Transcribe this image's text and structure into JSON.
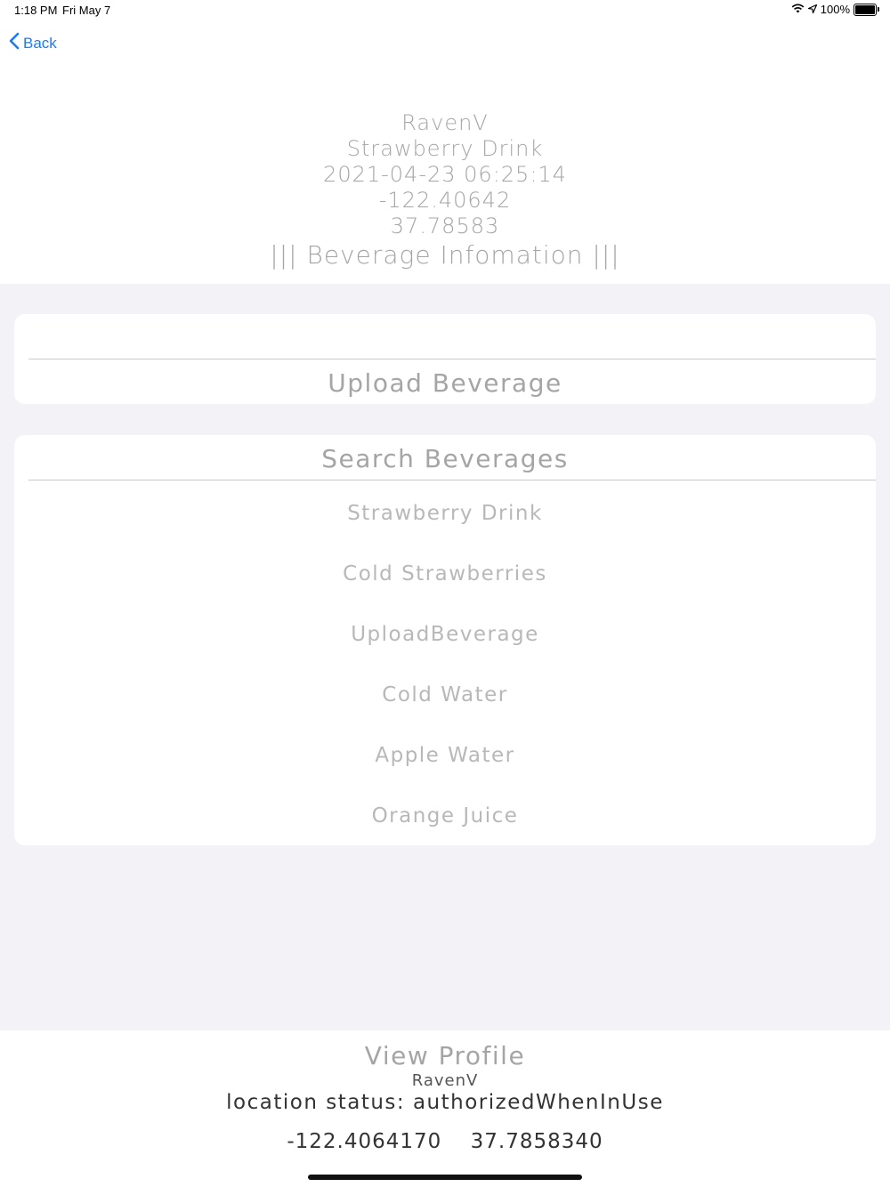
{
  "status_bar": {
    "time": "1:18 PM",
    "date": "Fri May 7",
    "battery": "100%",
    "icons": [
      "wifi-icon",
      "location-arrow-icon",
      "battery-icon"
    ]
  },
  "nav": {
    "back_label": "Back",
    "accent_color": "#1a7cf5"
  },
  "info": {
    "user": "RavenV",
    "beverage": "Strawberry Drink",
    "timestamp": "2021-04-23 06:25:14",
    "longitude": "-122.40642",
    "latitude": "37.78583",
    "section_title": "||| Beverage Infomation |||"
  },
  "actions": {
    "upload_label": "Upload Beverage"
  },
  "search": {
    "header_label": "Search Beverages",
    "items": [
      "Strawberry Drink",
      "Cold Strawberries",
      "UploadBeverage",
      "Cold Water",
      "Apple Water",
      "Orange Juice"
    ]
  },
  "footer": {
    "view_profile_label": "View Profile",
    "user": "RavenV",
    "location_status": "location status: authorizedWhenInUse",
    "longitude": "-122.4064170",
    "latitude": "37.7858340"
  }
}
